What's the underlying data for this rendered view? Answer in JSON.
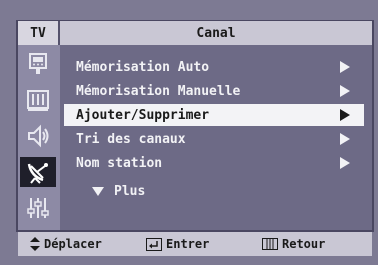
{
  "header": {
    "tab_label": "TV",
    "title": "Canal"
  },
  "sidebar": {
    "icons": [
      {
        "name": "picture-icon",
        "selected": false
      },
      {
        "name": "sound-icon",
        "selected": false
      },
      {
        "name": "speaker-icon",
        "selected": false
      },
      {
        "name": "channel-antenna-icon",
        "selected": true
      },
      {
        "name": "setup-sliders-icon",
        "selected": false
      }
    ]
  },
  "menu": {
    "items": [
      {
        "label": "Mémorisation Auto",
        "selected": false
      },
      {
        "label": "Mémorisation Manuelle",
        "selected": false
      },
      {
        "label": "Ajouter/Supprimer",
        "selected": true
      },
      {
        "label": "Tri des canaux",
        "selected": false
      },
      {
        "label": "Nom station",
        "selected": false
      }
    ],
    "more_label": "Plus"
  },
  "footer": {
    "move_label": "Déplacer",
    "enter_label": "Entrer",
    "return_label": "Retour"
  },
  "colors": {
    "background": "#7d7a93",
    "bar": "#c9c7d4",
    "highlight": "#f3f3f6",
    "selected_icon_bg": "#1f1f2a"
  }
}
